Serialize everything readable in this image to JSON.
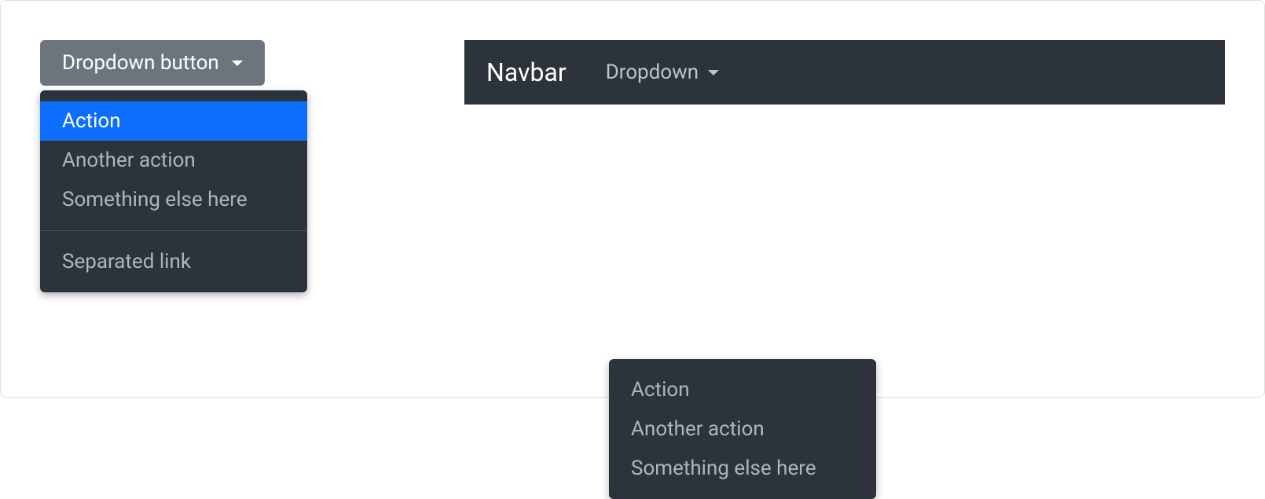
{
  "left": {
    "button_label": "Dropdown button",
    "menu": {
      "items": [
        "Action",
        "Another action",
        "Something else here"
      ],
      "separated": "Separated link"
    }
  },
  "right": {
    "navbar_brand": "Navbar",
    "nav_dropdown_label": "Dropdown",
    "menu": {
      "items": [
        "Action",
        "Another action",
        "Something else here"
      ]
    }
  }
}
